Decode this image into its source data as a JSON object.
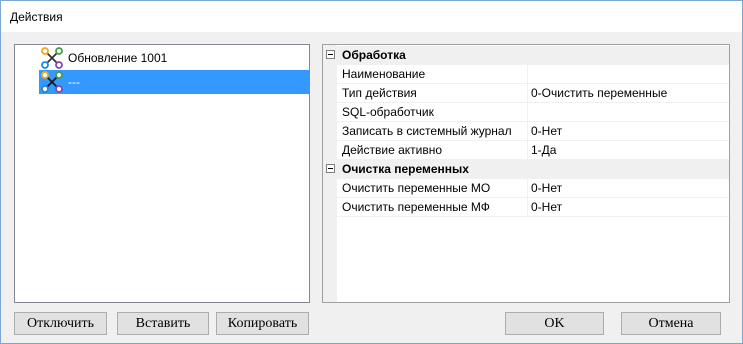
{
  "window": {
    "title": "Действия"
  },
  "tree": {
    "items": [
      {
        "label": "Обновление 1001",
        "selected": false,
        "icon": "action-node-icon"
      },
      {
        "label": "---",
        "selected": true,
        "icon": "action-node-icon"
      }
    ]
  },
  "properties": {
    "categories": [
      {
        "label": "Обработка",
        "rows": [
          {
            "name": "Наименование",
            "value": ""
          },
          {
            "name": "Тип действия",
            "value": "0-Очистить переменные"
          },
          {
            "name": "SQL-обработчик",
            "value": ""
          },
          {
            "name": "Записать в системный журнал",
            "value": "0-Нет"
          },
          {
            "name": "Действие активно",
            "value": "1-Да"
          }
        ]
      },
      {
        "label": "Очистка переменных",
        "rows": [
          {
            "name": "Очистить переменные МО",
            "value": "0-Нет"
          },
          {
            "name": "Очистить переменные МФ",
            "value": "0-Нет"
          }
        ]
      }
    ]
  },
  "buttons": {
    "disable": "Отключить",
    "insert": "Вставить",
    "copy": "Копировать",
    "ok": "OK",
    "cancel": "Отмена"
  },
  "colors": {
    "selection": "#3399ff",
    "window_border": "#7aa7d6",
    "icon_orange": "#f5a623",
    "icon_blue": "#1e88e5",
    "icon_green": "#43a047",
    "icon_purple": "#8e44ad"
  }
}
